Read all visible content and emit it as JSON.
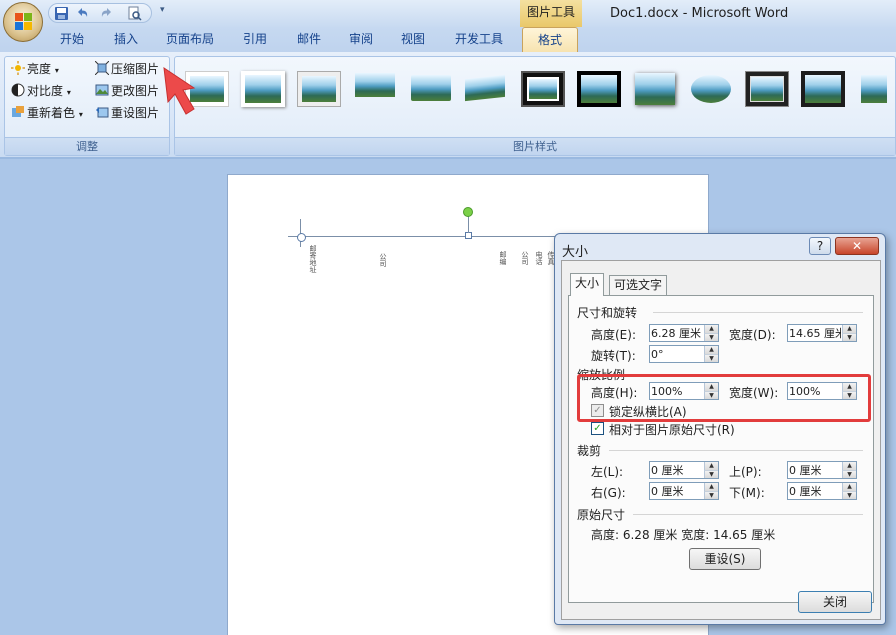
{
  "titlebar": {
    "context_title": "图片工具",
    "window_title": "Doc1.docx - Microsoft Word",
    "qat_icons": [
      "save-icon",
      "undo-icon",
      "redo-icon",
      "print-preview-icon",
      "customize-qat-icon"
    ]
  },
  "tabs": [
    "开始",
    "插入",
    "页面布局",
    "引用",
    "邮件",
    "审阅",
    "视图",
    "开发工具",
    "格式"
  ],
  "active_tab": "格式",
  "ribbon": {
    "adjust": {
      "items": [
        {
          "label": "亮度",
          "icon": "brightness-icon"
        },
        {
          "label": "对比度",
          "icon": "contrast-icon"
        },
        {
          "label": "重新着色",
          "icon": "recolor-icon"
        },
        {
          "label": "压缩图片",
          "icon": "compress-pictures-icon"
        },
        {
          "label": "更改图片",
          "icon": "change-picture-icon"
        },
        {
          "label": "重设图片",
          "icon": "reset-picture-icon"
        }
      ],
      "group_label": "调整"
    },
    "picture_styles": {
      "group_label": "图片样式",
      "style_count": 13
    }
  },
  "document": {
    "vertical_texts": [
      "邮寄地址",
      "公司",
      "邮编",
      "公司",
      "电话",
      "传真"
    ]
  },
  "dialog": {
    "title": "大小",
    "help_label": "?",
    "close_x_label": "✕",
    "tabs": [
      "大小",
      "可选文字"
    ],
    "sections": {
      "size_rotate": "尺寸和旋转",
      "scale": "缩放比例",
      "crop": "裁剪",
      "original": "原始尺寸"
    },
    "fields": {
      "height_label": "高度(E):",
      "height_value": "6.28 厘米",
      "width_label": "宽度(D):",
      "width_value": "14.65 厘米",
      "rotate_label": "旋转(T):",
      "rotate_value": "0°",
      "scale_height_label": "高度(H):",
      "scale_height_value": "100%",
      "scale_width_label": "宽度(W):",
      "scale_width_value": "100%",
      "lock_ratio_label": "锁定纵横比(A)",
      "relative_label": "相对于图片原始尺寸(R)",
      "crop_left_label": "左(L):",
      "crop_left_value": "0 厘米",
      "crop_top_label": "上(P):",
      "crop_top_value": "0 厘米",
      "crop_right_label": "右(G):",
      "crop_right_value": "0 厘米",
      "crop_bottom_label": "下(M):",
      "crop_bottom_value": "0 厘米"
    },
    "original": {
      "text": "高度:  6.28 厘米   宽度:  14.65 厘米"
    },
    "reset_label": "重设(S)",
    "close_label": "关闭"
  }
}
